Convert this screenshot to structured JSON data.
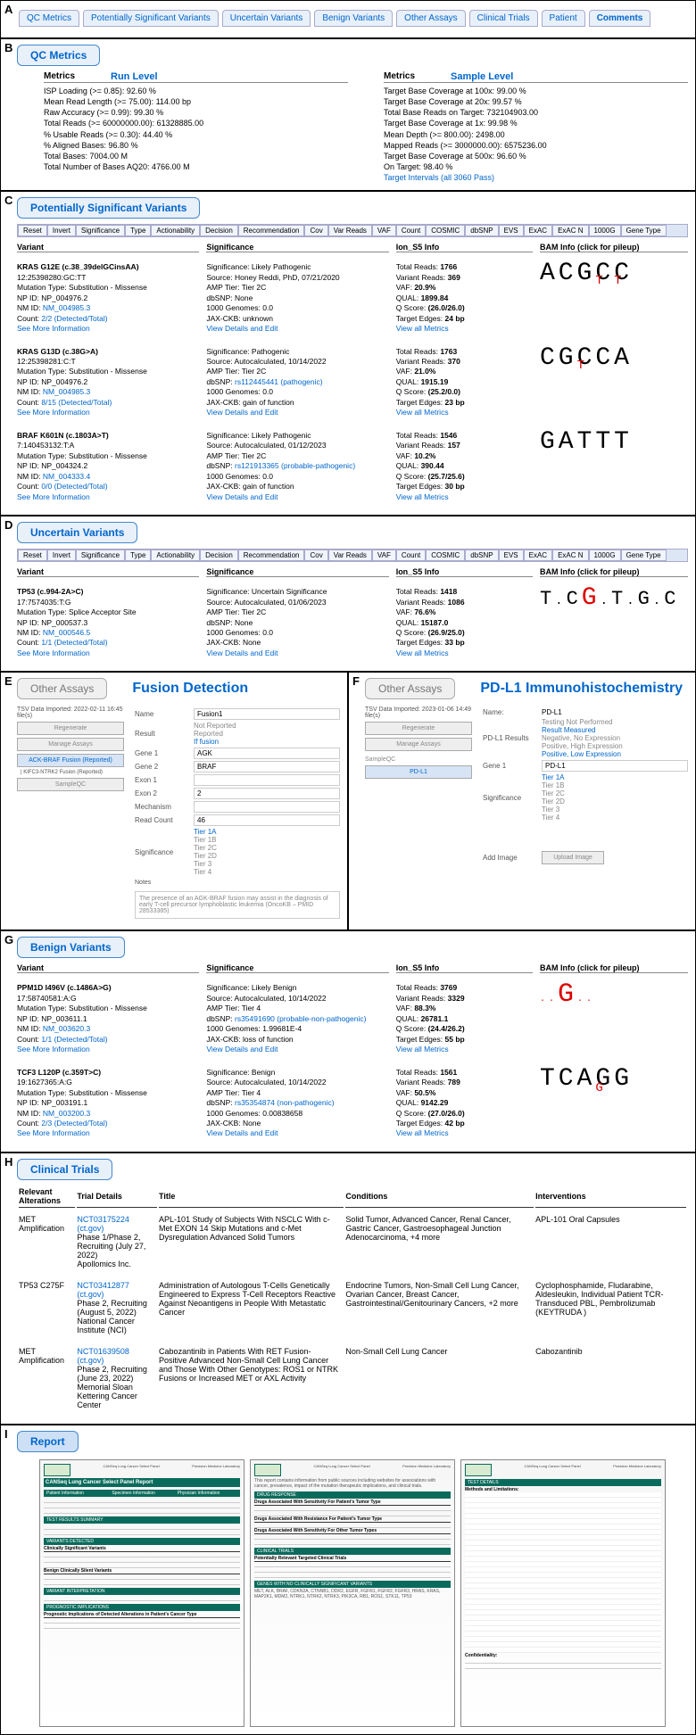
{
  "tabs": {
    "qc": "QC Metrics",
    "psv": "Potentially Significant Variants",
    "uv": "Uncertain Variants",
    "bv": "Benign Variants",
    "oa": "Other Assays",
    "ct": "Clinical Trials",
    "pt": "Patient",
    "cm": "Comments"
  },
  "letters": {
    "A": "A",
    "B": "B",
    "C": "C",
    "D": "D",
    "E": "E",
    "F": "F",
    "G": "G",
    "H": "H",
    "I": "I"
  },
  "sections": {
    "qc": "QC Metrics",
    "psv": "Potentially Significant Variants",
    "uv": "Uncertain Variants",
    "oa": "Other Assays",
    "bv": "Benign Variants",
    "ct": "Clinical Trials",
    "report": "Report"
  },
  "qc": {
    "metrics_label": "Metrics",
    "run_level": "Run Level",
    "sample_level": "Sample Level",
    "run": {
      "isp": "ISP Loading (>= 0.85): 92.60 %",
      "mrl": "Mean Read Length (>= 75.00): 114.00 bp",
      "raw": "Raw Accuracy (>= 0.99): 99.30 %",
      "tot": "Total Reads (>= 60000000.00): 61328885.00",
      "usable": "% Usable Reads (>= 0.30): 44.40 %",
      "aligned": "% Aligned Bases: 96.80 %",
      "tb": "Total Bases: 7004.00 M",
      "aq20": "Total Number of Bases AQ20: 4766.00 M"
    },
    "samp": {
      "t100": "Target Base Coverage at 100x: 99.00 %",
      "t20": "Target Base Coverage at 20x: 99.57 %",
      "tbr": "Total Base Reads on Target: 732104903.00",
      "t1": "Target Base Coverage at 1x: 99.98 %",
      "md": "Mean Depth (>= 800.00): 2498.00",
      "mr": "Mapped Reads (>= 3000000.00): 6575236.00",
      "t500": "Target Base Coverage at 500x: 96.60 %",
      "ot": "On Target: 98.40 %",
      "ti": "Target Intervals (all 3060 Pass)"
    }
  },
  "filters": {
    "reset": "Reset",
    "invert": "Invert",
    "sig": "Significance",
    "type": "Type",
    "act": "Actionability",
    "dec": "Decision",
    "rec": "Recommendation",
    "cov": "Cov",
    "vr": "Var Reads",
    "vaf": "VAF",
    "count": "Count",
    "cosmic": "COSMIC",
    "dbsnp": "dbSNP",
    "evs": "EVS",
    "exac": "ExAC",
    "exacn": "ExAC N",
    "g1000": "1000G",
    "gt": "Gene Type"
  },
  "cols": {
    "variant": "Variant",
    "sig": "Significance",
    "ion": "Ion_S5 Info",
    "bam": "BAM Info (click for pileup)"
  },
  "psv": {
    "v1": {
      "t": "KRAS G12E (c.38_39delGCinsAA)",
      "loc": "12:25398280:GC:TT",
      "mut": "Mutation Type: Substitution - Missense",
      "np": "NP ID: NP_004976.2",
      "nm": "NM ID: NM_004985.3",
      "count": "Count: 2/2 (Detected/Total)",
      "more": "See More Information",
      "s1": "Significance: Likely Pathogenic",
      "s2": "Source: Honey Reddi, PhD, 07/21/2020",
      "s3": "AMP Tier: Tier 2C",
      "s4": "dbSNP: None",
      "s5": "1000 Genomes: 0.0",
      "s6": "JAX-CKB: unknown",
      "sedit": "View Details and Edit",
      "i1": "Total Reads:",
      "i1v": "1766",
      "i2": "Variant Reads:",
      "i2v": "369",
      "i3": "VAF:",
      "i3v": "20.9%",
      "i4": "QUAL:",
      "i4v": "1899.84",
      "i5": "Q Score:",
      "i5v": "(26.0/26.0)",
      "i6": "Target Edges:",
      "i6v": "24 bp",
      "iall": "View all Metrics",
      "bam": "ACGCC",
      "bam_sub": "TT"
    },
    "v2": {
      "t": "KRAS G13D (c.38G>A)",
      "loc": "12:25398281:C:T",
      "mut": "Mutation Type: Substitution - Missense",
      "np": "NP ID: NP_004976.2",
      "nm": "NM ID: NM_004985.3",
      "count": "Count: 8/15 (Detected/Total)",
      "more": "See More Information",
      "s1": "Significance: Pathogenic",
      "s2": "Source: Autocalculated, 10/14/2022",
      "s3": "AMP Tier: Tier 2C",
      "s4pre": "dbSNP: ",
      "s4link": "rs112445441 (pathogenic)",
      "s5": "1000 Genomes: 0.0",
      "s6": "JAX-CKB: gain of function",
      "sedit": "View Details and Edit",
      "i1": "Total Reads:",
      "i1v": "1763",
      "i2": "Variant Reads:",
      "i2v": "370",
      "i3": "VAF:",
      "i3v": "21.0%",
      "i4": "QUAL:",
      "i4v": "1915.19",
      "i5": "Q Score:",
      "i5v": "(25.2/0.0)",
      "i6": "Target Edges:",
      "i6v": "23 bp",
      "iall": "View all Metrics",
      "bam": "CGCCA",
      "bam_sub": "T"
    },
    "v3": {
      "t": "BRAF K601N (c.1803A>T)",
      "loc": "7:140453132:T:A",
      "mut": "Mutation Type: Substitution - Missense",
      "np": "NP ID: NP_004324.2",
      "nm": "NM ID: NM_004333.4",
      "count": "Count: 0/0 (Detected/Total)",
      "more": "See More Information",
      "s1": "Significance: Likely Pathogenic",
      "s2": "Source: Autocalculated, 01/12/2023",
      "s3": "AMP Tier: Tier 2C",
      "s4pre": "dbSNP: ",
      "s4link": "rs121913365 (probable-pathogenic)",
      "s5": "1000 Genomes: 0.0",
      "s6": "JAX-CKB: gain of function",
      "sedit": "View Details and Edit",
      "i1": "Total Reads:",
      "i1v": "1546",
      "i2": "Variant Reads:",
      "i2v": "157",
      "i3": "VAF:",
      "i3v": "10.2%",
      "i4": "QUAL:",
      "i4v": "390.44",
      "i5": "Q Score:",
      "i5v": "(25.7/25.6)",
      "i6": "Target Edges:",
      "i6v": "30 bp",
      "iall": "View all Metrics",
      "bam": "GATTT",
      "bam_sub": ""
    }
  },
  "uv": {
    "v1": {
      "t": "TP53 (c.994-2A>C)",
      "loc": "17:7574035:T:G",
      "mut": "Mutation Type: Splice Acceptor Site",
      "np": "NP ID: NP_000537.3",
      "nm": "NM ID: NM_000546.5",
      "count": "Count: 1/1 (Detected/Total)",
      "more": "See More Information",
      "s1": "Significance: Uncertain Significance",
      "s2": "Source: Autocalculated, 01/06/2023",
      "s3": "AMP Tier: Tier 2C",
      "s4": "dbSNP: None",
      "s5": "1000 Genomes: 0.0",
      "s6": "JAX-CKB: None",
      "sedit": "View Details and Edit",
      "i1": "Total Reads:",
      "i1v": "1418",
      "i2": "Variant Reads:",
      "i2v": "1086",
      "i3": "VAF:",
      "i3v": "76.6%",
      "i4": "QUAL:",
      "i4v": "15187.0",
      "i5": "Q Score:",
      "i5v": "(26.9/25.0)",
      "i6": "Target Edges:",
      "i6v": "33 bp",
      "iall": "View all Metrics"
    }
  },
  "bv": {
    "v1": {
      "t": "PPM1D I496V (c.1486A>G)",
      "loc": "17:58740581:A:G",
      "mut": "Mutation Type: Substitution - Missense",
      "np": "NP ID: NP_003611.1",
      "nm": "NM ID: NM_003620.3",
      "count": "Count: 1/1 (Detected/Total)",
      "more": "See More Information",
      "s1": "Significance: Likely Benign",
      "s2": "Source: Autocalculated, 10/14/2022",
      "s3": "AMP Tier: Tier 4",
      "s4pre": "dbSNP: ",
      "s4link": "rs35491690 (probable-non-pathogenic)",
      "s5": "1000 Genomes: 1.99681E-4",
      "s6": "JAX-CKB: loss of function",
      "sedit": "View Details and Edit",
      "i1": "Total Reads:",
      "i1v": "3769",
      "i2": "Variant Reads:",
      "i2v": "3329",
      "i3": "VAF:",
      "i3v": "88.3%",
      "i4": "QUAL:",
      "i4v": "26781.1",
      "i5": "Q Score:",
      "i5v": "(24.4/26.2)",
      "i6": "Target Edges:",
      "i6v": "55 bp",
      "iall": "View all Metrics"
    },
    "v2": {
      "t": "TCF3 L120P (c.359T>C)",
      "loc": "19:1627365:A:G",
      "mut": "Mutation Type: Substitution - Missense",
      "np": "NP ID: NP_003191.1",
      "nm": "NM ID: NM_003200.3",
      "count": "Count: 2/3 (Detected/Total)",
      "more": "See More Information",
      "s1": "Significance: Benign",
      "s2": "Source: Autocalculated, 10/14/2022",
      "s3": "AMP Tier: Tier 4",
      "s4pre": "dbSNP: ",
      "s4link": "rs35354874 (non-pathogenic)",
      "s5": "1000 Genomes: 0.00838658",
      "s6": "JAX-CKB: None",
      "sedit": "View Details and Edit",
      "i1": "Total Reads:",
      "i1v": "1561",
      "i2": "Variant Reads:",
      "i2v": "789",
      "i3": "VAF:",
      "i3v": "50.5%",
      "i4": "QUAL:",
      "i4v": "9142.29",
      "i5": "Q Score:",
      "i5v": "(27.0/26.0)",
      "i6": "Target Edges:",
      "i6v": "42 bp",
      "iall": "View all Metrics"
    }
  },
  "fusion": {
    "title": "Fusion Detection",
    "imported": "TSV Data Imported: 2022-02-11 16:45 file(s)",
    "regen": "Regenerate",
    "manage": "Manage Assays",
    "tab": "ACK-BRAF Fusion (Reported)",
    "sub": "| KIFC3-NTRK2 Fusion (Reported)",
    "qc": "SampleQC",
    "name_lab": "Name",
    "name_val": "Fusion1",
    "result_lab": "Result",
    "r1": "Not Reported",
    "r2": "Reported",
    "r3": "If fusion",
    "gene1_lab": "Gene 1",
    "gene1_val": "AGK",
    "gene2_lab": "Gene 2",
    "gene2_val": "BRAF",
    "exon1_lab": "Exon 1",
    "exon1_val": "",
    "exon2_lab": "Exon 2",
    "exon2_val": "2",
    "mech_lab": "Mechanism",
    "mech_val": "",
    "reads_lab": "Read Count",
    "reads_val": "46",
    "sig_lab": "Significance",
    "t1a": "Tier 1A",
    "t1b": "Tier 1B",
    "t2c": "Tier 2C",
    "t2d": "Tier 2D",
    "t3": "Tier 3",
    "t4": "Tier 4",
    "notes_lab": "Notes",
    "notes": "The presence of an AGK-BRAF fusion may assist in the diagnosis of early T-cell precursor lymphoblastic leukemia (OncoKB – PMID 28533385)"
  },
  "pdl1": {
    "title": "PD-L1 Immunohistochemistry",
    "imported": "TSV Data Imported: 2023-01-06 14:49 file(s)",
    "regen": "Regenerate",
    "manage": "Manage Assays",
    "qc": "SampleQC",
    "tab": "PD-L1",
    "name_lab": "Name:",
    "name_val": "PD-L1",
    "res_lab": "PD-L1 Results",
    "r1": "Testing Not Performed",
    "r2": "Result Measured",
    "r3": "Negative, No Expression",
    "r4": "Positive, High Expression",
    "r5": "Positive, Low Expression",
    "gene1_lab": "Gene 1",
    "gene1_val": "PD-L1",
    "sig_lab": "Significance",
    "t1a": "Tier 1A",
    "t1b": "Tier 1B",
    "t2c": "Tier 2C",
    "t2d": "Tier 2D",
    "t3": "Tier 3",
    "t4": "Tier 4",
    "add_lab": "Add Image",
    "upload": "Upload Image"
  },
  "trials": {
    "h1": "Relevant Alterations",
    "h2": "Trial Details",
    "h3": "Title",
    "h4": "Conditions",
    "h5": "Interventions",
    "r1": {
      "alt": "MET Amplification",
      "nct": "NCT03175224 (ct.gov)",
      "det": "Phase 1/Phase 2, Recruiting (July 27, 2022)\nApollomics Inc.",
      "title": "APL-101 Study of Subjects With NSCLC With c-Met EXON 14 Skip Mutations and c-Met Dysregulation Advanced Solid Tumors",
      "cond": "Solid Tumor, Advanced Cancer, Renal Cancer, Gastric Cancer, Gastroesophageal Junction Adenocarcinoma, +4 more",
      "int": "APL-101 Oral Capsules"
    },
    "r2": {
      "alt": "TP53 C275F",
      "nct": "NCT03412877 (ct.gov)",
      "det": "Phase 2, Recruiting (August 5, 2022)\nNational Cancer Institute (NCI)",
      "title": "Administration of Autologous T-Cells Genetically Engineered to Express T-Cell Receptors Reactive Against Neoantigens in People With Metastatic Cancer",
      "cond": "Endocrine Tumors, Non-Small Cell Lung Cancer, Ovarian Cancer, Breast Cancer, Gastrointestinal/Genitourinary Cancers, +2 more",
      "int": "Cyclophosphamide, Fludarabine, Aldesleukin, Individual Patient TCR-Transduced PBL, Pembrolizumab (KEYTRUDA )"
    },
    "r3": {
      "alt": "MET Amplification",
      "nct": "NCT01639508 (ct.gov)",
      "det": "Phase 2, Recruiting (June 23, 2022)\nMemorial Sloan Kettering Cancer Center",
      "title": "Cabozantinib in Patients With RET Fusion-Positive Advanced Non-Small Cell Lung Cancer and Those With Other Genotypes: ROS1 or NTRK Fusions or Increased MET or AXL Activity",
      "cond": "Non-Small Cell Lung Cancer",
      "int": "Cabozantinib"
    }
  },
  "report": {
    "hdr": "CANSeq Lung Cancer Select Panel Report",
    "p1": {
      "s1": "Patient Information",
      "s1a": "Specimen Information",
      "s1b": "Physician Information",
      "s2": "TEST RESULTS SUMMARY",
      "s3": "VARIANTS DETECTED",
      "s3a": "Clinically Significant Variants",
      "s4": "Benign Clinically Silent Variants",
      "s5": "VARIANT INTERPRETATION",
      "s6": "PROGNOSTIC IMPLICATIONS",
      "s6a": "Prognostic Implications of Detected Alterations in Patient's Cancer Type"
    },
    "p2": {
      "s1": "DRUG RESPONSE",
      "s2": "Drugs Associated With Sensitivity For Patient's Tumor Type",
      "s3": "Drugs Associated With Resistance For Patient's Tumor Type",
      "s4": "Drugs Associated With Sensitivity For Other Tumor Types",
      "s5": "CLINICAL TRIALS",
      "s5a": "Potentially Relevant Targeted Clinical Trials",
      "s6": "GENES WITH NO CLINICALLY SIGNIFICANT VARIANTS"
    },
    "p3": {
      "s1": "TEST DETAILS",
      "s2": "Methods and Limitations:",
      "s3": "Confidentiality:"
    },
    "note": "This report contains information from public sources including websites for associations with cancer, prevalence, impact of the mutation therapeutic implications, and clinical trials.",
    "genelist": "MET, ALK, BRAF, CDKN2A, CTNNB1, DDR2, EGFR, FGFR1, FGFR2, FGFR3, HRAS, KRAS, MAP2K1, MDM2, NTRK1, NTRK2, NTRK3, PIK3CA, RB1, ROS1, STK11, TP53"
  }
}
